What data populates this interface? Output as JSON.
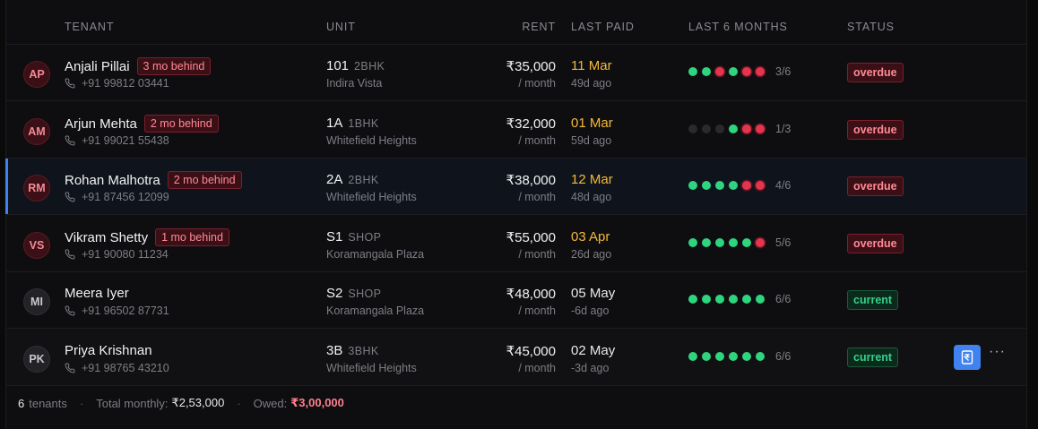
{
  "header": {
    "tenant": "TENANT",
    "unit": "UNIT",
    "rent": "RENT",
    "last_paid": "LAST PAID",
    "last6": "LAST 6 MONTHS",
    "status": "STATUS"
  },
  "rows": [
    {
      "initials": "AP",
      "avatar_style": "red",
      "name": "Anjali Pillai",
      "behind": "3 mo behind",
      "phone": "+91 99812 03441",
      "unit": "101",
      "unit_type": "2BHK",
      "property": "Indira Vista",
      "rent": "₹35,000",
      "per": "/ month",
      "last_paid": "11 Mar",
      "ago": "49d ago",
      "paid_late": true,
      "months": [
        "g",
        "g",
        "r",
        "g",
        "r",
        "r"
      ],
      "count": "3/6",
      "status": "overdue"
    },
    {
      "initials": "AM",
      "avatar_style": "red",
      "name": "Arjun Mehta",
      "behind": "2 mo behind",
      "phone": "+91 99021 55438",
      "unit": "1A",
      "unit_type": "1BHK",
      "property": "Whitefield Heights",
      "rent": "₹32,000",
      "per": "/ month",
      "last_paid": "01 Mar",
      "ago": "59d ago",
      "paid_late": true,
      "months": [
        "e",
        "e",
        "e",
        "g",
        "r",
        "r"
      ],
      "count": "1/3",
      "status": "overdue"
    },
    {
      "initials": "RM",
      "avatar_style": "red",
      "name": "Rohan Malhotra",
      "behind": "2 mo behind",
      "phone": "+91 87456 12099",
      "unit": "2A",
      "unit_type": "2BHK",
      "property": "Whitefield Heights",
      "rent": "₹38,000",
      "per": "/ month",
      "last_paid": "12 Mar",
      "ago": "48d ago",
      "paid_late": true,
      "months": [
        "g",
        "g",
        "g",
        "g",
        "r",
        "r"
      ],
      "count": "4/6",
      "status": "overdue",
      "selected": true
    },
    {
      "initials": "VS",
      "avatar_style": "red",
      "name": "Vikram Shetty",
      "behind": "1 mo behind",
      "phone": "+91 90080 11234",
      "unit": "S1",
      "unit_type": "SHOP",
      "property": "Koramangala Plaza",
      "rent": "₹55,000",
      "per": "/ month",
      "last_paid": "03 Apr",
      "ago": "26d ago",
      "paid_late": true,
      "months": [
        "g",
        "g",
        "g",
        "g",
        "g",
        "r"
      ],
      "count": "5/6",
      "status": "overdue"
    },
    {
      "initials": "MI",
      "avatar_style": "gray",
      "name": "Meera Iyer",
      "behind": "",
      "phone": "+91 96502 87731",
      "unit": "S2",
      "unit_type": "SHOP",
      "property": "Koramangala Plaza",
      "rent": "₹48,000",
      "per": "/ month",
      "last_paid": "05 May",
      "ago": "-6d ago",
      "paid_late": false,
      "months": [
        "g",
        "g",
        "g",
        "g",
        "g",
        "g"
      ],
      "count": "6/6",
      "status": "current"
    },
    {
      "initials": "PK",
      "avatar_style": "gray",
      "name": "Priya Krishnan",
      "behind": "",
      "phone": "+91 98765 43210",
      "unit": "3B",
      "unit_type": "3BHK",
      "property": "Whitefield Heights",
      "rent": "₹45,000",
      "per": "/ month",
      "last_paid": "02 May",
      "ago": "-3d ago",
      "paid_late": false,
      "months": [
        "g",
        "g",
        "g",
        "g",
        "g",
        "g"
      ],
      "count": "6/6",
      "status": "current",
      "hovered": true,
      "more_label": "···"
    }
  ],
  "footer": {
    "count": "6",
    "count_label": "tenants",
    "total_label": "Total monthly:",
    "total_value": "₹2,53,000",
    "owed_label": "Owed:",
    "owed_value": "₹3,00,000",
    "sep": "·"
  },
  "colors": {
    "accent": "#3f82f0",
    "overdue": "#ff8a95",
    "current": "#34d08a",
    "late_date": "#f5b93a"
  }
}
